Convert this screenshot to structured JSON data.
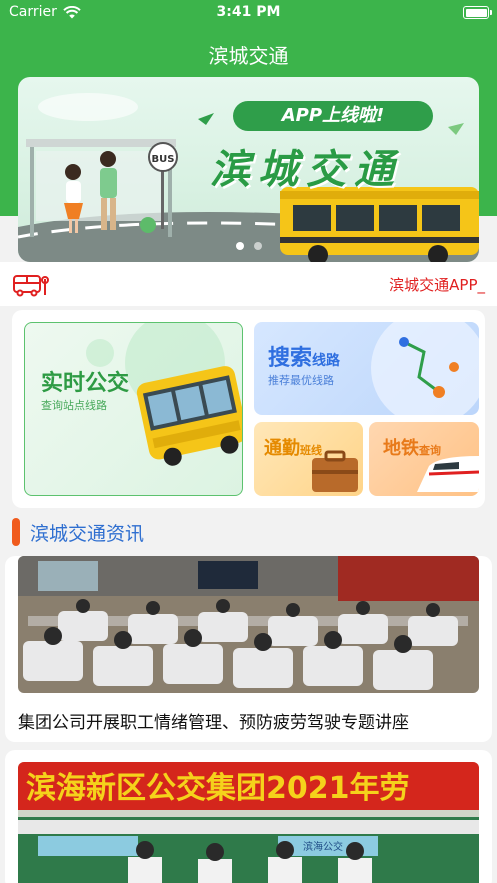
{
  "status_bar": {
    "carrier": "Carrier",
    "time": "3:41 PM"
  },
  "nav": {
    "title": "滨城交通"
  },
  "banner": {
    "headline": "APP上线啦!",
    "brand": "滨城交通",
    "bus_sign": "BUS",
    "page_count": 2,
    "active_page": 1
  },
  "notice": {
    "text": "滨城交通APP_"
  },
  "services": {
    "realtime": {
      "title": "实时公交",
      "subtitle": "查询站点线路"
    },
    "search": {
      "title_big": "搜索",
      "title_small": "线路",
      "subtitle": "推荐最优线路"
    },
    "commute": {
      "title_big": "通勤",
      "title_small": "班线"
    },
    "subway": {
      "title_big": "地铁",
      "title_small": "查询"
    }
  },
  "news_section": {
    "title": "滨城交通资讯"
  },
  "news": [
    {
      "caption": "集团公司开展职工情绪管理、预防疲劳驾驶专题讲座"
    },
    {
      "photo_banner_text": "滨海新区公交集团2021年劳",
      "bus_label": "滨海公交"
    }
  ],
  "colors": {
    "primary_green": "#3cb44b",
    "accent_red": "#e02020",
    "section_blue": "#2f6fd0",
    "section_orange": "#f05b1d"
  }
}
